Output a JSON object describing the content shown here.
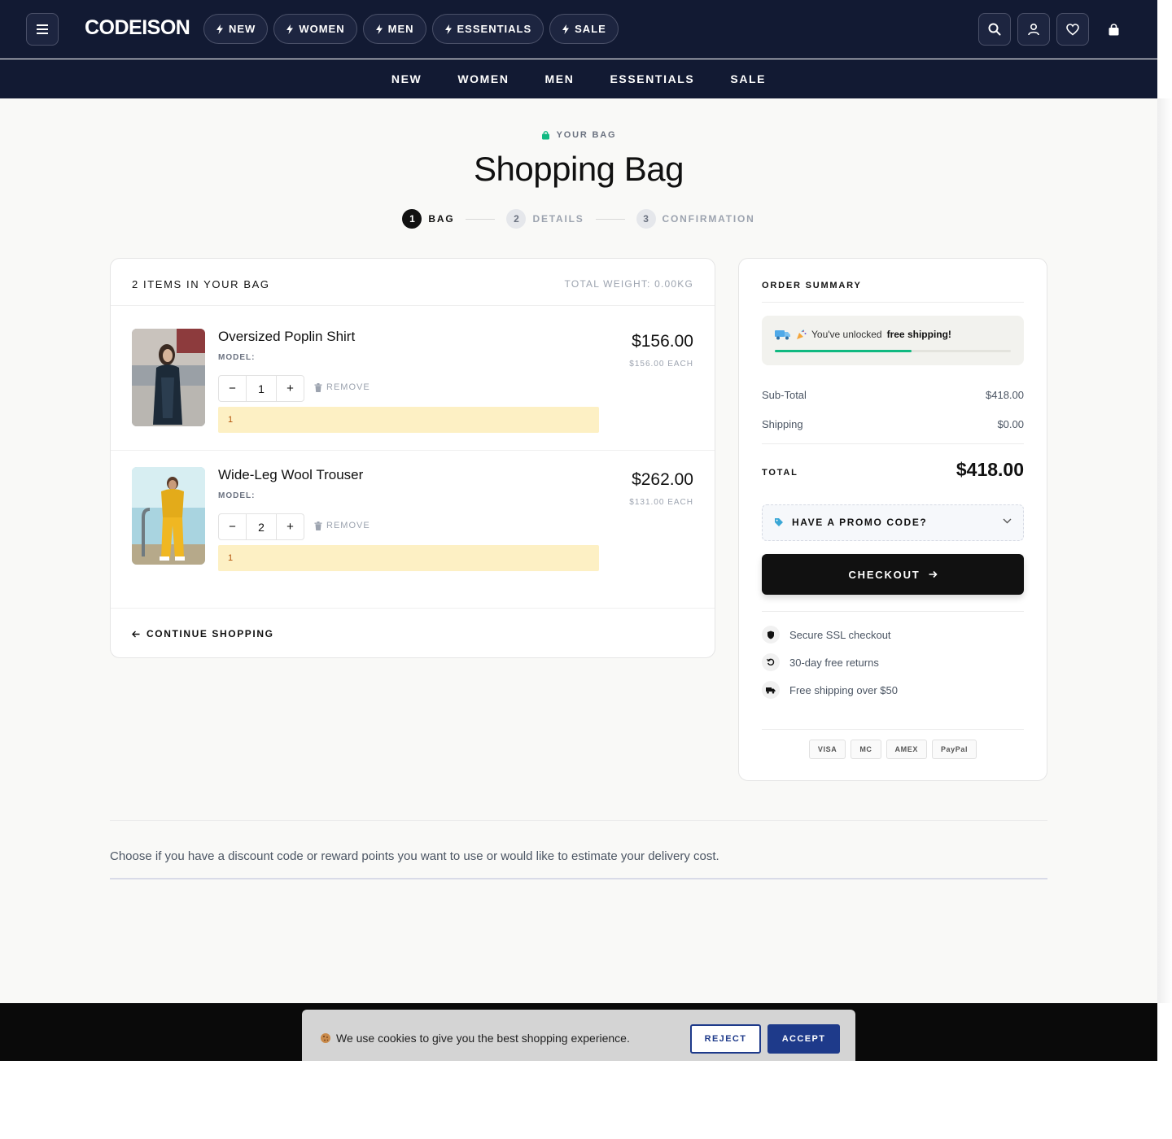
{
  "header": {
    "brand": "CODEISON",
    "pills": [
      "NEW",
      "WOMEN",
      "MEN",
      "ESSENTIALS",
      "SALE"
    ],
    "nav": [
      "NEW",
      "WOMEN",
      "MEN",
      "ESSENTIALS",
      "SALE"
    ],
    "icons": [
      "menu-icon",
      "search-icon",
      "user-icon",
      "heart-icon",
      "bag-icon"
    ]
  },
  "hero": {
    "kicker": "YOUR BAG",
    "title": "Shopping Bag",
    "steps": [
      {
        "num": "1",
        "label": "BAG"
      },
      {
        "num": "2",
        "label": "DETAILS"
      },
      {
        "num": "3",
        "label": "CONFIRMATION"
      }
    ]
  },
  "bag": {
    "count_label": "2 ITEMS IN YOUR BAG",
    "weight_label": "TOTAL WEIGHT: 0.00KG",
    "items": [
      {
        "name": "Oversized Poplin Shirt",
        "model": "MODEL:",
        "qty": "1",
        "remove": "REMOVE",
        "note": "1",
        "price": "$156.00",
        "each": "$156.00 EACH"
      },
      {
        "name": "Wide-Leg Wool Trouser",
        "model": "MODEL:",
        "qty": "2",
        "remove": "REMOVE",
        "note": "1",
        "price": "$262.00",
        "each": "$131.00 EACH"
      }
    ],
    "minus": "−",
    "plus": "+",
    "continue": "CONTINUE SHOPPING"
  },
  "summary": {
    "title": "ORDER SUMMARY",
    "ship_prefix": "You've unlocked",
    "ship_bold": "free shipping!",
    "ship_progress": 0.58,
    "subtotal_label": "Sub-Total",
    "subtotal_value": "$418.00",
    "shipping_label": "Shipping",
    "shipping_value": "$0.00",
    "total_label": "TOTAL",
    "total_value": "$418.00",
    "promo_label": "HAVE A PROMO CODE?",
    "checkout_label": "CHECKOUT",
    "trust": [
      "Secure SSL checkout",
      "30-day free returns",
      "Free shipping over $50"
    ],
    "cards": [
      "VISA",
      "MC",
      "AMEX",
      "PayPal"
    ]
  },
  "discount": {
    "text": "Choose if you have a discount code or reward points you want to use or would like to estimate your delivery cost."
  },
  "cookie": {
    "text": "We use cookies to give you the best shopping experience.",
    "reject": "REJECT",
    "accept": "ACCEPT"
  },
  "colors": {
    "header_bg": "#121a33",
    "accent_green": "#10b981",
    "accept_blue": "#1e3a8a",
    "note_bg": "#fdf0c4"
  }
}
